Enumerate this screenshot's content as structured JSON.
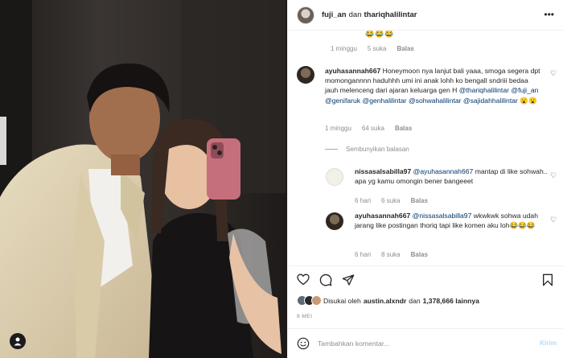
{
  "post": {
    "author": "fuji_an",
    "connector": "dan",
    "coauthor": "thariqhalilintar",
    "more_icon": "more-horizontal-icon"
  },
  "previous_comment": {
    "emojis": "😂😂😂",
    "time": "1 minggu",
    "likes": "5 suka",
    "reply": "Balas"
  },
  "main_comment": {
    "username": "ayuhasannah667",
    "text_before": "Honeymoon nya lanjut bali yaaa, smoga segera dpt momongannnn haduhhh umi ini anak lohh ko bengall sndriii bedaa jauh melenceng dari ajaran keluarga gen H",
    "mentions": [
      "@thariqhalilintar",
      "@fuji_an",
      "@genifaruk",
      "@genhalilintar",
      "@sohwahalilintar",
      "@sajidahhalilintar"
    ],
    "emojis": "😮😮",
    "time": "1 minggu",
    "likes": "64 suka",
    "reply": "Balas"
  },
  "hide_replies": "Sembunyikan balasan",
  "replies": [
    {
      "username": "nissasalsabilla97",
      "mention": "@ayuhasannah667",
      "text": "mantap di like sohwah.. apa yg kamu omongin bener bangeeet",
      "time": "6 hari",
      "likes": "6 suka",
      "reply": "Balas"
    },
    {
      "username": "ayuhasannah667",
      "mention": "@nissasalsabilla97",
      "text": "wkwkwk sohwa udah jarang like postingan thoriq tapi like komen aku loh",
      "emojis": "😂😂😂",
      "time": "6 hari",
      "likes": "8 suka",
      "reply": "Balas"
    }
  ],
  "liked_by": {
    "prefix": "Disukai oleh",
    "user": "austin.alxndr",
    "connector": "dan",
    "others": "1,378,666 lainnya"
  },
  "date": "8 MEI",
  "comment_box": {
    "placeholder": "Tambahkan komentar...",
    "send": "Kirim"
  },
  "colors": {
    "link": "#00376b",
    "muted": "#8e8e8e",
    "send_disabled": "#b3dbff"
  }
}
